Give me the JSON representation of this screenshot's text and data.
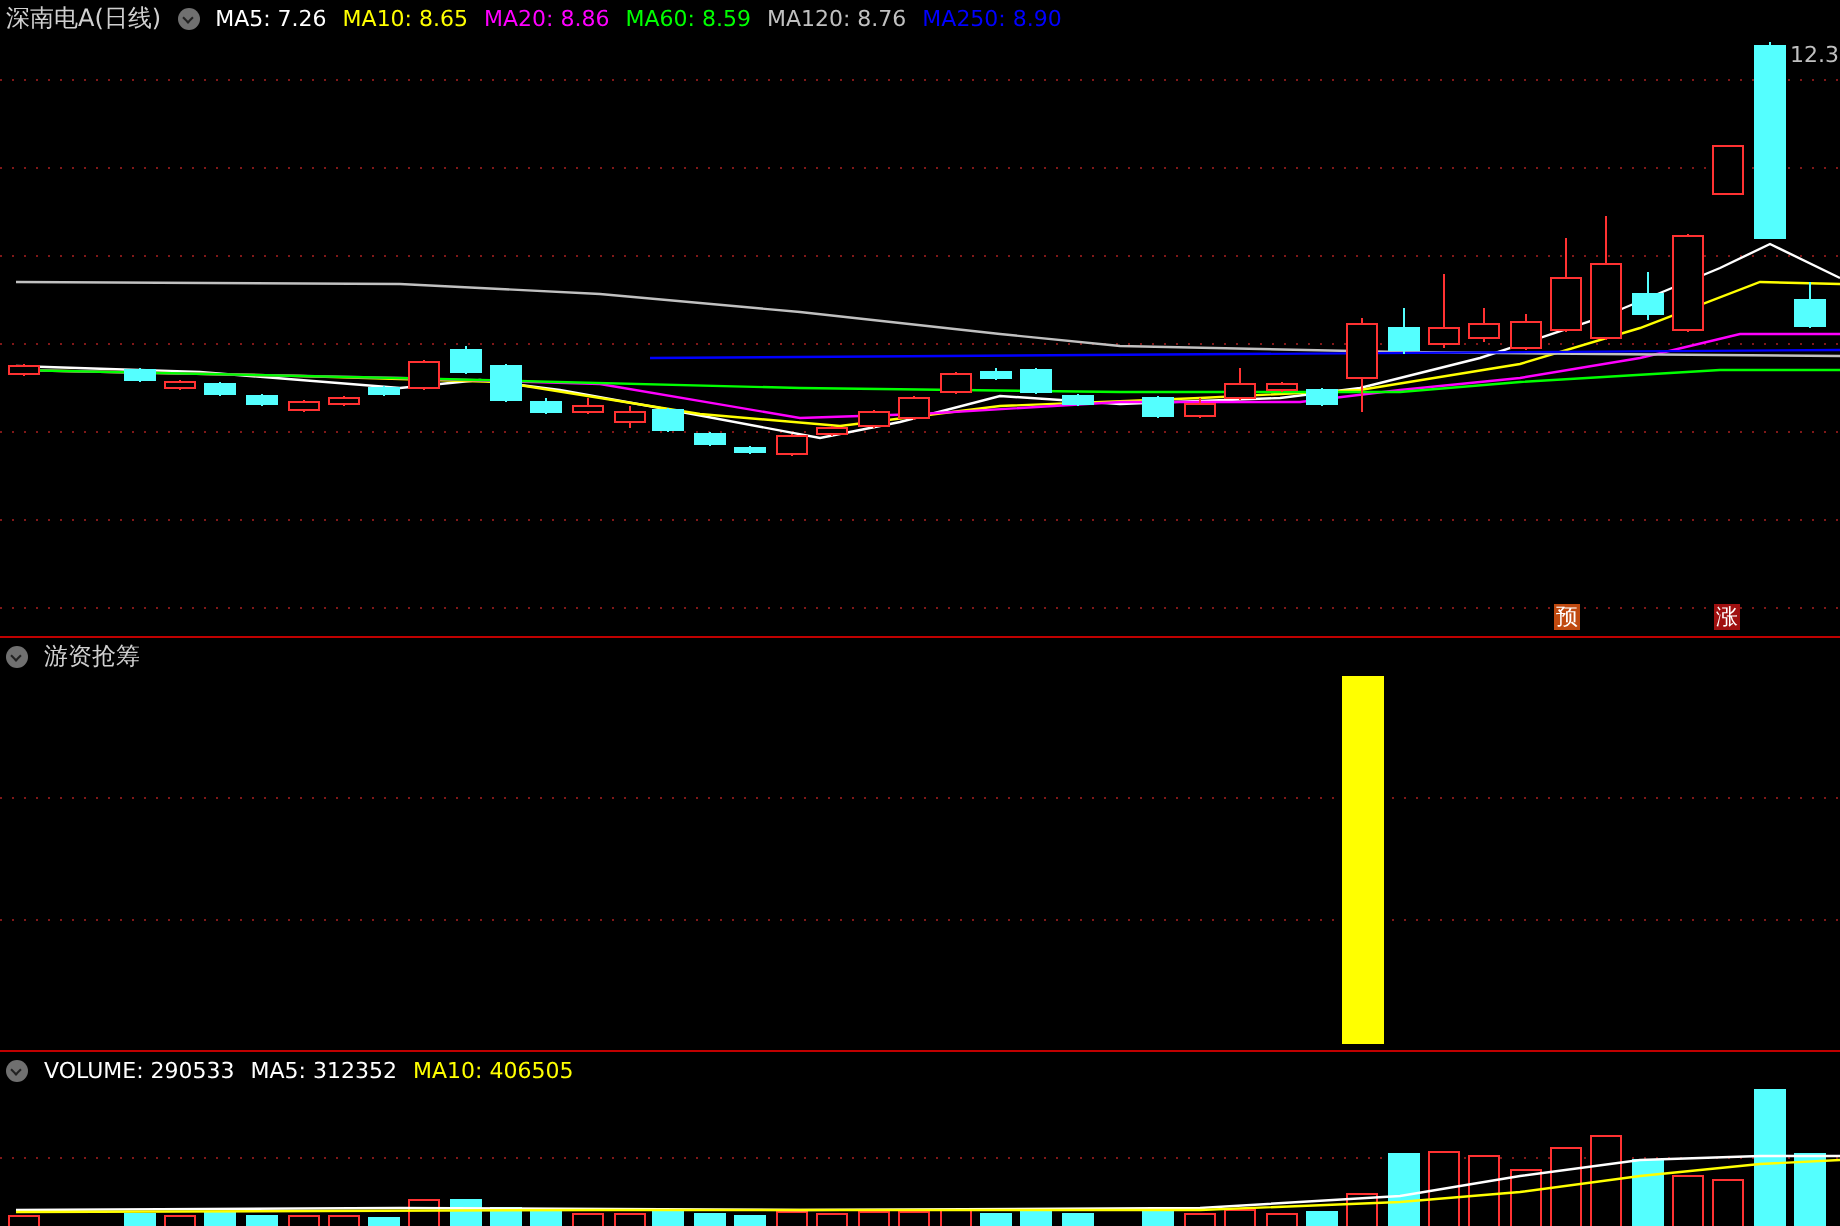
{
  "main_panel": {
    "title": "深南电A(日线)",
    "legend": [
      {
        "label": "MA5: 7.26",
        "color": "#ffffff"
      },
      {
        "label": "MA10: 8.65",
        "color": "#ffff00"
      },
      {
        "label": "MA20: 8.86",
        "color": "#ff00ff"
      },
      {
        "label": "MA60: 8.59",
        "color": "#00ff00"
      },
      {
        "label": "MA120: 8.76",
        "color": "#c0c0c0"
      },
      {
        "label": "MA250: 8.90",
        "color": "#0000ff"
      }
    ],
    "price_label": "12.3",
    "markers": [
      {
        "text": "预",
        "color": "#c04a10"
      },
      {
        "text": "涨",
        "color": "#a01010"
      }
    ]
  },
  "indicator_panel": {
    "title": "游资抢筹"
  },
  "volume_panel": {
    "legend": [
      {
        "label": "VOLUME: 290533",
        "color": "#ffffff"
      },
      {
        "label": "MA5: 312352",
        "color": "#ffffff"
      },
      {
        "label": "MA10: 406505",
        "color": "#ffff00"
      }
    ]
  }
}
